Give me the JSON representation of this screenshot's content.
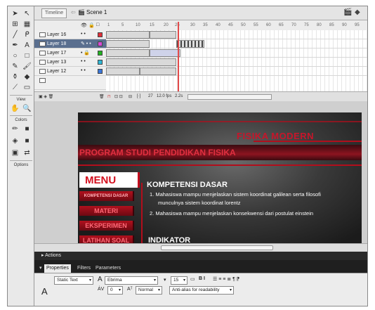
{
  "timeline": {
    "tab_label": "Timeline",
    "scene_label": "Scene 1",
    "ruler": [
      "1",
      "5",
      "10",
      "15",
      "20",
      "25",
      "30",
      "35",
      "40",
      "45",
      "50",
      "55",
      "60",
      "65",
      "70",
      "75",
      "80",
      "85",
      "90",
      "95"
    ],
    "layers": [
      {
        "name": "Layer 16",
        "color": "#e0303a",
        "selected": false
      },
      {
        "name": "Layer 18",
        "color": "#d84ad6",
        "selected": true
      },
      {
        "name": "Layer 17",
        "color": "#22b322",
        "selected": false
      },
      {
        "name": "Layer 13",
        "color": "#2fb7d6",
        "selected": false
      },
      {
        "name": "Layer 12",
        "color": "#3b77d8",
        "selected": false
      }
    ],
    "footer": {
      "frame": "27",
      "fps": "12.0 fps",
      "time": "2.2s"
    }
  },
  "tools": {
    "view_label": "View",
    "colors_label": "Colors",
    "options_label": "Options"
  },
  "stage": {
    "fisika_modern": "FISIKA MODERN",
    "prodi": "PROGRAM STUDI PENDIDIKAN FISIKA",
    "menu_title": "MENU",
    "menu_items": [
      "KOMPETENSI DASAR",
      "MATERI",
      "EKSPERIMEN",
      "LATIHAN SOAL"
    ],
    "kd_title": "KOMPETENSI DASAR",
    "kd_lines": [
      "1. Mahasiswa mampu menjelaskan sistem koordinat  galilean serta filosofi",
      "munculnya sistem koordinat  lorentz",
      "2. Mahasiswa mampu menjelaskan konsekwensi dari  postulat einstein"
    ],
    "indikator": "INDIKATOR"
  },
  "panels": {
    "actions": "Actions",
    "tabs": [
      "Properties",
      "Filters",
      "Parameters"
    ]
  },
  "properties": {
    "text_type": "Static Text",
    "font": "Ebrima",
    "size": "15",
    "letter_spacing": "0",
    "baseline": "Normal",
    "anti_alias": "Anti-alias for readability",
    "format_buttons": "B  I",
    "A_glyph": "A"
  }
}
